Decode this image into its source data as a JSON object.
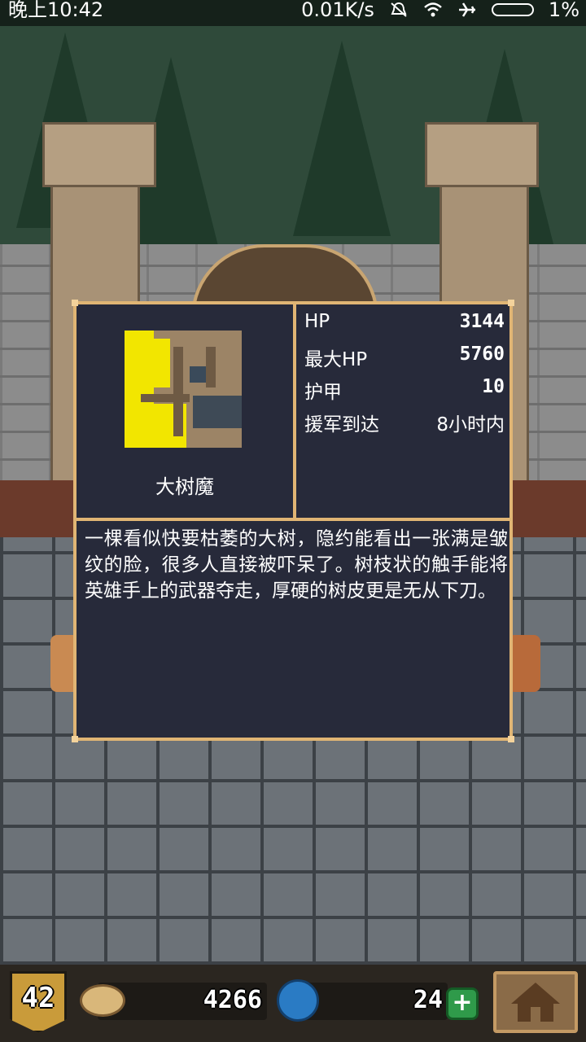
{
  "status_bar": {
    "time": "晚上10:42",
    "net_speed": "0.01K/s",
    "battery": "1%"
  },
  "monster": {
    "name": "大树魔",
    "portrait_icon": "tree-monster-icon",
    "stats": [
      {
        "label": "HP",
        "value": "3144"
      },
      {
        "label": "最大HP",
        "value": "5760"
      },
      {
        "label": "护甲",
        "value": "10"
      },
      {
        "label": "援军到达",
        "value": "8小时内"
      }
    ],
    "description": "一棵看似快要枯萎的大树，隐约能看出一张满是皱纹的脸，很多人直接被吓呆了。树枝状的触手能将英雄手上的武器夺走，厚硬的树皮更是无从下刀。"
  },
  "bottom_bar": {
    "level": "42",
    "gold": "4266",
    "gems": "24",
    "plus_label": "+"
  },
  "colors": {
    "panel_border": "#e0b574",
    "panel_bg": "#272a3a",
    "portrait_yellow": "#f2e600"
  }
}
